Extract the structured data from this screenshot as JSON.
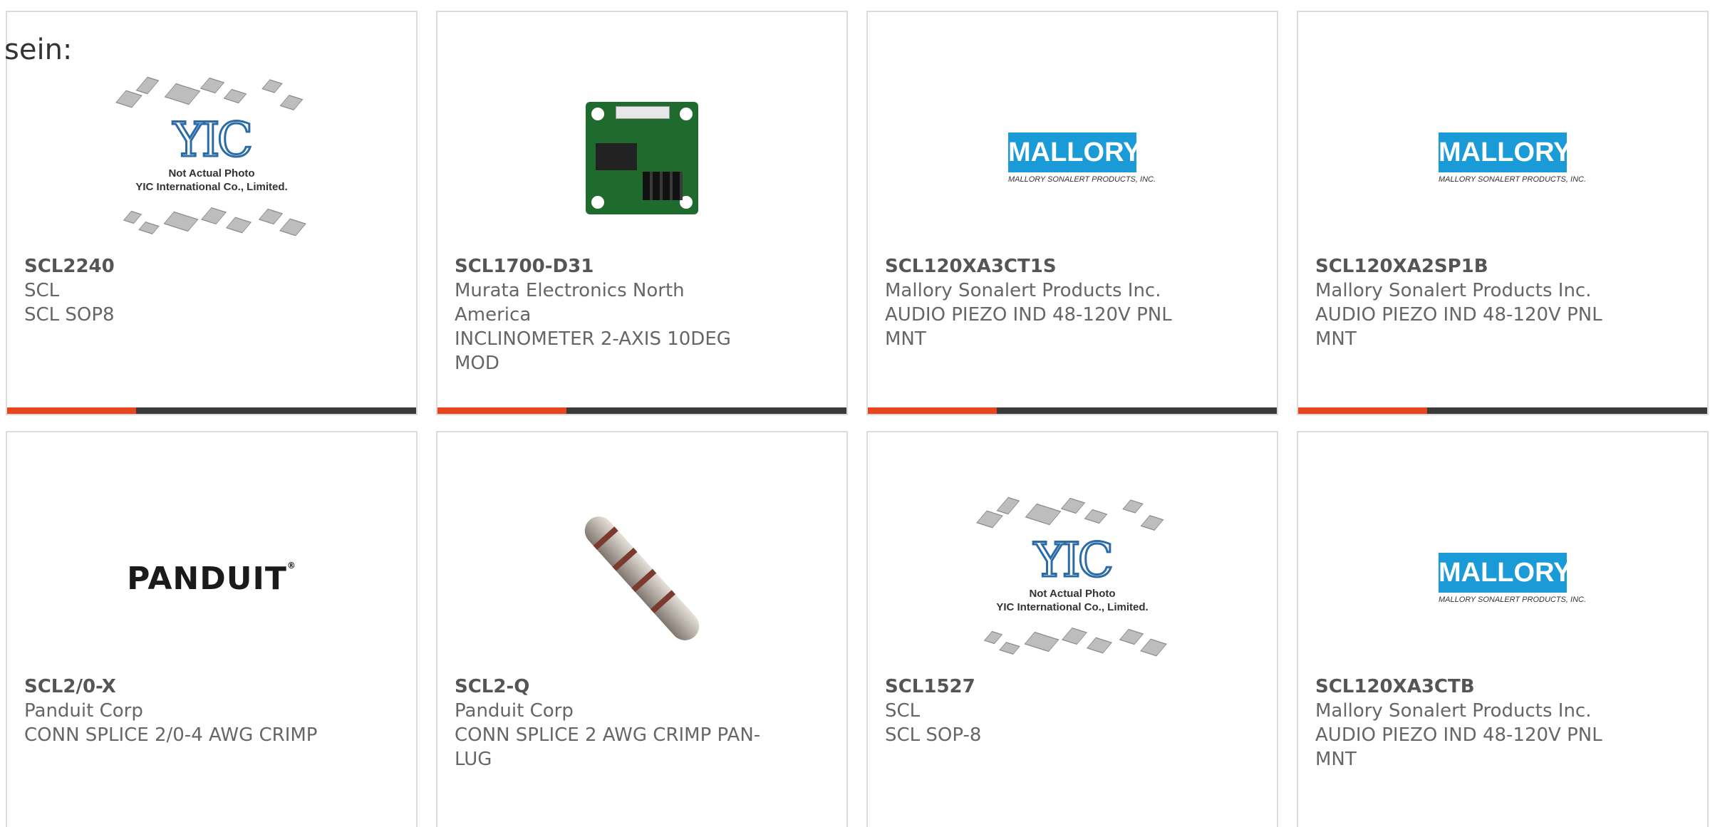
{
  "intro_text": "sein:",
  "cards": [
    {
      "part_number": "SCL2240",
      "manufacturer": "SCL",
      "description": "SCL SOP8",
      "image": "yic-placeholder",
      "image_caption_line1": "Not Actual Photo",
      "image_caption_line2": "YIC International Co., Limited.",
      "image_logo": "YIC"
    },
    {
      "part_number": "SCL1700-D31",
      "manufacturer": "Murata Electronics North America",
      "description": "INCLINOMETER 2-AXIS 10DEG MOD",
      "image": "inclinometer-board"
    },
    {
      "part_number": "SCL120XA3CT1S",
      "manufacturer": "Mallory Sonalert Products Inc.",
      "description": "AUDIO PIEZO IND 48-120V PNL MNT",
      "image": "mallory-logo",
      "image_logo": "MALLORY",
      "image_subtext": "MALLORY SONALERT PRODUCTS, INC."
    },
    {
      "part_number": "SCL120XA2SP1B",
      "manufacturer": "Mallory Sonalert Products Inc.",
      "description": "AUDIO PIEZO IND 48-120V PNL MNT",
      "image": "mallory-logo",
      "image_logo": "MALLORY",
      "image_subtext": "MALLORY SONALERT PRODUCTS, INC."
    },
    {
      "part_number": "SCL2/0-X",
      "manufacturer": "Panduit Corp",
      "description": "CONN SPLICE 2/0-4 AWG CRIMP",
      "image": "panduit-logo",
      "image_logo": "PANDUIT"
    },
    {
      "part_number": "SCL2-Q",
      "manufacturer": "Panduit Corp",
      "description": "CONN SPLICE 2 AWG CRIMP PAN-LUG",
      "image": "splice-photo"
    },
    {
      "part_number": "SCL1527",
      "manufacturer": "SCL",
      "description": "SCL SOP-8",
      "image": "yic-placeholder",
      "image_caption_line1": "Not Actual Photo",
      "image_caption_line2": "YIC International Co., Limited.",
      "image_logo": "YIC"
    },
    {
      "part_number": "SCL120XA3CTB",
      "manufacturer": "Mallory Sonalert Products Inc.",
      "description": "AUDIO PIEZO IND 48-120V PNL MNT",
      "image": "mallory-logo",
      "image_logo": "MALLORY",
      "image_subtext": "MALLORY SONALERT PRODUCTS, INC."
    }
  ],
  "colors": {
    "accent": "#e8441e",
    "bar": "#3a3a3a",
    "border": "#dcdcdc",
    "text": "#666666",
    "mallory_blue": "#1a9ad6",
    "yic_blue": "#2b6ca8"
  }
}
